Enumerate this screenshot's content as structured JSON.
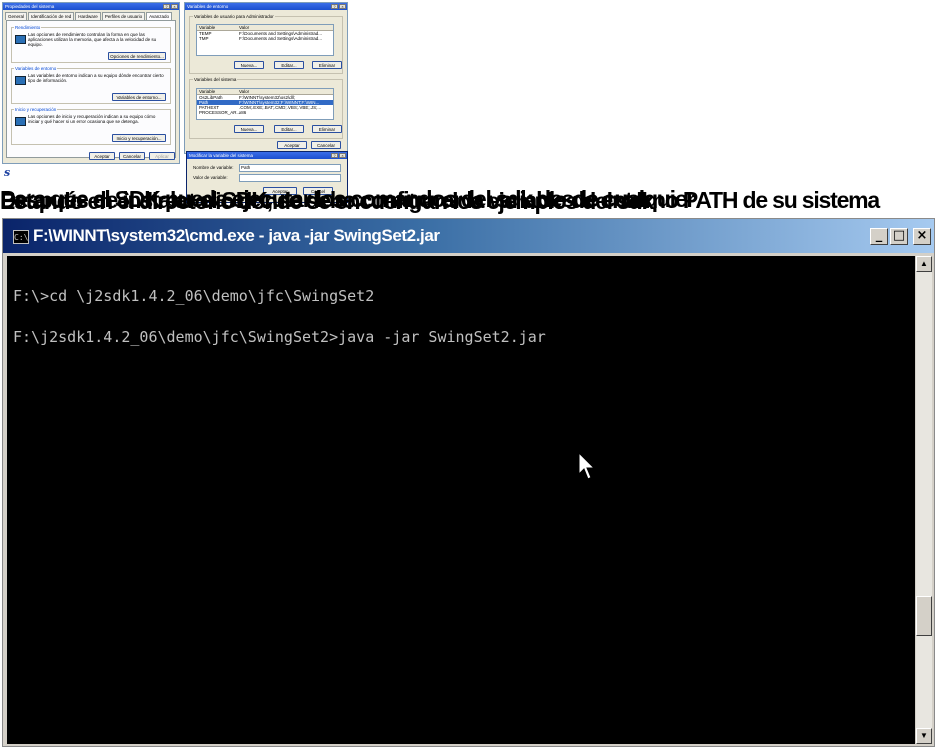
{
  "sysprops": {
    "title": "Propiedades del sistema",
    "tabs": [
      "General",
      "Identificación de red",
      "Hardware",
      "Perfiles de usuario",
      "Avanzado"
    ],
    "rendimiento": {
      "title": "Rendimiento",
      "text": "Las opciones de rendimiento controlan la forma en que las aplicaciones utilizan la memoria, que afecta a la velocidad de su equipo.",
      "button": "Opciones de rendimiento..."
    },
    "variables": {
      "title": "Variables de entorno",
      "text": "Las variables de entorno indican a su equipo dónde encontrar cierto tipo de información.",
      "button": "Variables de entorno..."
    },
    "inicio": {
      "title": "Inicio y recuperación",
      "text": "Las opciones de inicio y recuperación indican a su equipo cómo iniciar y qué hacer si un error ocasiona que se detenga.",
      "button": "Inicio y recuperación..."
    },
    "ok": "Aceptar",
    "cancel": "Cancelar",
    "apply": "Aplicar"
  },
  "envvars": {
    "title": "Variables de entorno",
    "user_group": "Variables de usuario para Administrador",
    "col_var": "Variable",
    "col_val": "Valor",
    "user_rows": [
      {
        "var": "TEMP",
        "val": "F:\\Documents and Settings\\Administrad..."
      },
      {
        "var": "TMP",
        "val": "F:\\Documents and Settings\\Administrad..."
      }
    ],
    "sys_group": "Variables del sistema",
    "sys_rows": [
      {
        "var": "Os2LibPath",
        "val": "F:\\WINNT\\system32\\os2\\dll;"
      },
      {
        "var": "Path",
        "val": "F:\\WINNT\\system32;F:\\WINNT;F:\\WIN..."
      },
      {
        "var": "PATHEXT",
        "val": ".COM;.EXE;.BAT;.CMD;.VBS;.VBE;.JS;..."
      },
      {
        "var": "PROCESSOR_AR...",
        "val": "x86"
      }
    ],
    "new": "Nueva...",
    "edit": "Editar...",
    "delete": "Eliminar",
    "ok": "Aceptar",
    "cancel": "Cancelar"
  },
  "modvar": {
    "title": "Modificar la variable del sistema",
    "name_label": "Nombre de variable:",
    "name_value": "Path",
    "value_label": "Valor de variable:",
    "value_value": "F:\\system32\\Wbem;F:\\j2sdk1.4.2_06\\bin",
    "ok": "Aceptar",
    "cancel": "Cancel"
  },
  "desktop_glyph": "s",
  "caption_lines": [
    "Para que el SDK pueda ejecutar los comandos del sdk desde cualquier",
    "Después de instalar el SDK, se debe configurar la variable de entorno PATH de su sistema",
    "Estando en el directorio donde se encuentran los ejemplos del sdk"
  ],
  "cmd": {
    "title": "F:\\WINNT\\system32\\cmd.exe - java -jar SwingSet2.jar",
    "icon_text": "C:\\",
    "minimize": "_",
    "maximize": "□",
    "close": "×",
    "lines": [
      "F:\\>cd \\j2sdk1.4.2_06\\demo\\jfc\\SwingSet2",
      "F:\\j2sdk1.4.2_06\\demo\\jfc\\SwingSet2>java -jar SwingSet2.jar"
    ],
    "scroll_up": "▲",
    "scroll_down": "▼"
  }
}
